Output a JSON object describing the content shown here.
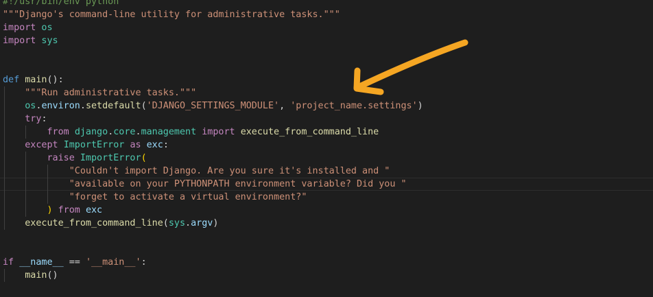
{
  "colors": {
    "background": "#1e1e1e",
    "keyword": "#569cd6",
    "control": "#c586c0",
    "function": "#dcdcaa",
    "string": "#ce9178",
    "comment": "#6a9955",
    "variable": "#9cdcfe",
    "class": "#4ec9b0",
    "bracket": "#ffd700",
    "plain": "#d4d4d4",
    "annotation_arrow": "#f5a623"
  },
  "code": [
    [
      {
        "t": "#!/usr/bin/env python",
        "c": "comment"
      }
    ],
    [
      {
        "t": "\"\"\"Django's command-line utility for administrative tasks.\"\"\"",
        "c": "string"
      }
    ],
    [
      {
        "t": "import",
        "c": "control"
      },
      {
        "t": " os",
        "c": "class"
      }
    ],
    [
      {
        "t": "import",
        "c": "control"
      },
      {
        "t": " sys",
        "c": "class"
      }
    ],
    [],
    [],
    [
      {
        "t": "def",
        "c": "keyword"
      },
      {
        "t": " ",
        "c": "plain"
      },
      {
        "t": "main",
        "c": "function"
      },
      {
        "t": "():",
        "c": "plain"
      }
    ],
    [
      {
        "t": "    \"\"\"Run administrative tasks.\"\"\"",
        "c": "string"
      }
    ],
    [
      {
        "t": "    ",
        "c": "plain"
      },
      {
        "t": "os",
        "c": "class"
      },
      {
        "t": ".",
        "c": "plain"
      },
      {
        "t": "environ",
        "c": "variable"
      },
      {
        "t": ".",
        "c": "plain"
      },
      {
        "t": "setdefault",
        "c": "function"
      },
      {
        "t": "(",
        "c": "plain"
      },
      {
        "t": "'DJANGO_SETTINGS_MODULE'",
        "c": "string"
      },
      {
        "t": ", ",
        "c": "plain"
      },
      {
        "t": "'project_name.settings'",
        "c": "string"
      },
      {
        "t": ")",
        "c": "plain"
      }
    ],
    [
      {
        "t": "    ",
        "c": "plain"
      },
      {
        "t": "try",
        "c": "control"
      },
      {
        "t": ":",
        "c": "plain"
      }
    ],
    [
      {
        "t": "        ",
        "c": "plain"
      },
      {
        "t": "from",
        "c": "control"
      },
      {
        "t": " ",
        "c": "plain"
      },
      {
        "t": "django",
        "c": "class"
      },
      {
        "t": ".",
        "c": "plain"
      },
      {
        "t": "core",
        "c": "class"
      },
      {
        "t": ".",
        "c": "plain"
      },
      {
        "t": "management",
        "c": "class"
      },
      {
        "t": " ",
        "c": "plain"
      },
      {
        "t": "import",
        "c": "control"
      },
      {
        "t": " ",
        "c": "plain"
      },
      {
        "t": "execute_from_command_line",
        "c": "function"
      }
    ],
    [
      {
        "t": "    ",
        "c": "plain"
      },
      {
        "t": "except",
        "c": "control"
      },
      {
        "t": " ",
        "c": "plain"
      },
      {
        "t": "ImportError",
        "c": "class"
      },
      {
        "t": " ",
        "c": "plain"
      },
      {
        "t": "as",
        "c": "control"
      },
      {
        "t": " ",
        "c": "plain"
      },
      {
        "t": "exc",
        "c": "variable"
      },
      {
        "t": ":",
        "c": "plain"
      }
    ],
    [
      {
        "t": "        ",
        "c": "plain"
      },
      {
        "t": "raise",
        "c": "control"
      },
      {
        "t": " ",
        "c": "plain"
      },
      {
        "t": "ImportError",
        "c": "class"
      },
      {
        "t": "(",
        "c": "bracket"
      }
    ],
    [
      {
        "t": "            \"Couldn't import Django. Are you sure it's installed and \"",
        "c": "string"
      }
    ],
    [
      {
        "t": "            \"available on your PYTHONPATH environment variable? Did you \"",
        "c": "string"
      }
    ],
    [
      {
        "t": "            \"forget to activate a virtual environment?\"",
        "c": "string"
      }
    ],
    [
      {
        "t": "        ",
        "c": "plain"
      },
      {
        "t": ")",
        "c": "bracket"
      },
      {
        "t": " ",
        "c": "plain"
      },
      {
        "t": "from",
        "c": "control"
      },
      {
        "t": " ",
        "c": "plain"
      },
      {
        "t": "exc",
        "c": "variable"
      }
    ],
    [
      {
        "t": "    ",
        "c": "plain"
      },
      {
        "t": "execute_from_command_line",
        "c": "function"
      },
      {
        "t": "(",
        "c": "plain"
      },
      {
        "t": "sys",
        "c": "class"
      },
      {
        "t": ".",
        "c": "plain"
      },
      {
        "t": "argv",
        "c": "variable"
      },
      {
        "t": ")",
        "c": "plain"
      }
    ],
    [],
    [],
    [
      {
        "t": "if",
        "c": "control"
      },
      {
        "t": " ",
        "c": "plain"
      },
      {
        "t": "__name__",
        "c": "variable"
      },
      {
        "t": " == ",
        "c": "plain"
      },
      {
        "t": "'__main__'",
        "c": "string"
      },
      {
        "t": ":",
        "c": "plain"
      }
    ],
    [
      {
        "t": "    ",
        "c": "plain"
      },
      {
        "t": "main",
        "c": "function"
      },
      {
        "t": "()",
        "c": "plain"
      }
    ]
  ],
  "current_line": 14,
  "indent_guides": [
    {
      "level": 1,
      "from": 7,
      "to": 17
    },
    {
      "level": 2,
      "from": 10,
      "to": 10
    },
    {
      "level": 2,
      "from": 12,
      "to": 16
    },
    {
      "level": 3,
      "from": 13,
      "to": 15
    },
    {
      "level": 1,
      "from": 21,
      "to": 21
    }
  ]
}
